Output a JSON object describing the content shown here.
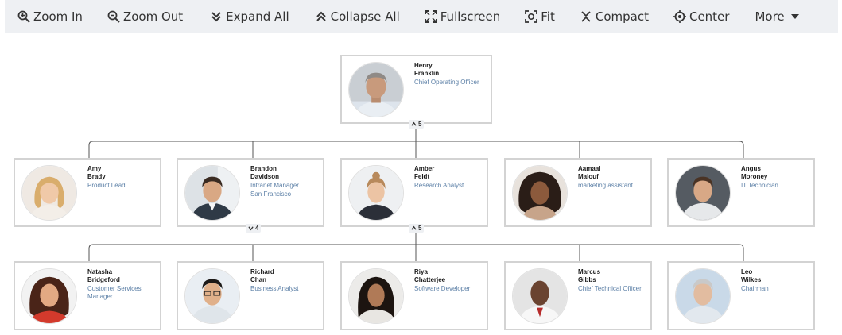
{
  "toolbar": {
    "zoom_in": "Zoom In",
    "zoom_out": "Zoom Out",
    "expand_all": "Expand All",
    "collapse_all": "Collapse All",
    "fullscreen": "Fullscreen",
    "fit": "Fit",
    "compact": "Compact",
    "center": "Center",
    "more": "More"
  },
  "colors": {
    "toolbar_bg": "#eef0f3",
    "card_border": "#d3d3d3",
    "title_text": "#5b7fa6",
    "connector": "#555555"
  },
  "org": {
    "root": {
      "first": "Henry",
      "last": "Franklin",
      "title": "Chief Operating Officer",
      "children_count": "5"
    },
    "level1": [
      {
        "first": "Amy",
        "last": "Brady",
        "title": "Product Lead"
      },
      {
        "first": "Brandon",
        "last": "Davidson",
        "title": "Intranet Manager",
        "sub": "San Francisco",
        "children_count": "4"
      },
      {
        "first": "Amber",
        "last": "Feldt",
        "title": "Research Analyst",
        "children_count": "5"
      },
      {
        "first": "Aamaal",
        "last": "Malouf",
        "title": "marketing assistant"
      },
      {
        "first": "Angus",
        "last": "Moroney",
        "title": "IT Technician"
      }
    ],
    "level2": [
      {
        "first": "Natasha",
        "last": "Bridgeford",
        "title": "Customer Services Manager"
      },
      {
        "first": "Richard",
        "last": "Chan",
        "title": "Business Analyst"
      },
      {
        "first": "Riya",
        "last": "Chatterjee",
        "title": "Software Developer"
      },
      {
        "first": "Marcus",
        "last": "Gibbs",
        "title": "Chief Technical Officer"
      },
      {
        "first": "Leo",
        "last": "Wilkes",
        "title": "Chairman"
      }
    ]
  }
}
